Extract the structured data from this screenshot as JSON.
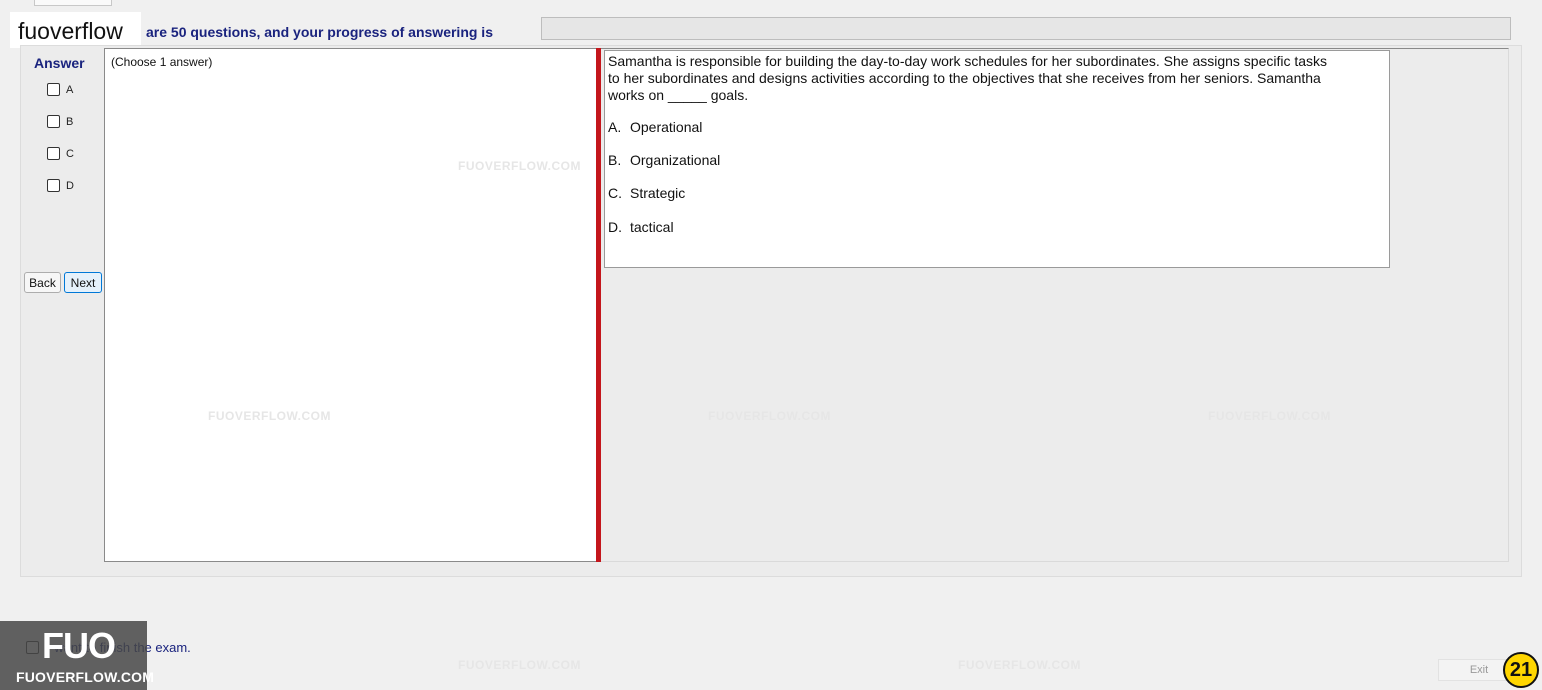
{
  "brand": {
    "name": "fuoverflow"
  },
  "header": {
    "progress_text": "are 50 questions, and your progress of answering is",
    "progress_value": 0
  },
  "answer_panel": {
    "title": "Answer",
    "options": [
      "A",
      "B",
      "C",
      "D"
    ],
    "back_label": "Back",
    "next_label": "Next"
  },
  "left_panel": {
    "instruction": "(Choose 1 answer)"
  },
  "question": {
    "text": "Samantha is responsible for building the day-to-day work schedules for her subordinates. She assigns specific tasks to her subordinates and designs activities according to the objectives that she receives from her seniors. Samantha works on _____ goals.",
    "choices": [
      {
        "letter": "A.",
        "text": "Operational"
      },
      {
        "letter": "B.",
        "text": "Organizational"
      },
      {
        "letter": "C.",
        "text": "Strategic"
      },
      {
        "letter": "D.",
        "text": "tactical"
      }
    ]
  },
  "watermark": "FUOVERFLOW.COM",
  "footer": {
    "finish_text": "I want to finish the exam.",
    "exit_label": "Exit",
    "logo_mark": "FUO",
    "logo_text": "FUOVERFLOW.COM",
    "page_number": "21"
  }
}
